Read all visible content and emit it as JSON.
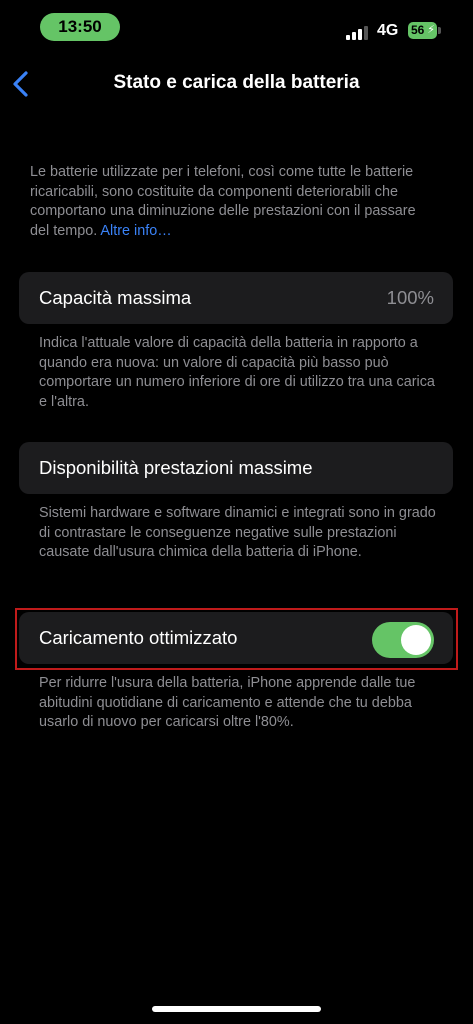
{
  "status_bar": {
    "time": "13:50",
    "network": "4G",
    "battery_level": "56",
    "signal_bars_active": 3,
    "signal_bars_total": 4
  },
  "nav": {
    "back_icon": "chevron-left-icon",
    "title": "Stato e carica della batteria"
  },
  "intro": {
    "text": "Le batterie utilizzate per i telefoni, così come tutte le batterie ricaricabili, sono costituite da componenti deteriorabili che comportano una diminuzione delle prestazioni con il passare del tempo.",
    "link": "Altre info…"
  },
  "max_capacity": {
    "label": "Capacità massima",
    "value": "100%",
    "footnote": "Indica l'attuale valore di capacità della batteria in rapporto a quando era nuova: un valore di capacità più basso può comportare un numero inferiore di ore di utilizzo tra una carica e l'altra."
  },
  "peak_performance": {
    "label": "Disponibilità prestazioni massime",
    "footnote": "Sistemi hardware e software dinamici e integrati sono in grado di contrastare le conseguenze negative sulle prestazioni causate dall'usura chimica della batteria di iPhone."
  },
  "optimized_charging": {
    "label": "Caricamento ottimizzato",
    "enabled": true,
    "footnote": "Per ridurre l'usura della batteria, iPhone apprende dalle tue abitudini quotidiane di caricamento e attende che tu debba usarlo di nuovo per caricarsi oltre l'80%."
  },
  "colors": {
    "accent_blue": "#3a82f7",
    "toggle_green": "#65c466",
    "cell_background": "#1c1c1e",
    "secondary_text": "#8e8e93",
    "highlight_red": "#c01b1b"
  }
}
